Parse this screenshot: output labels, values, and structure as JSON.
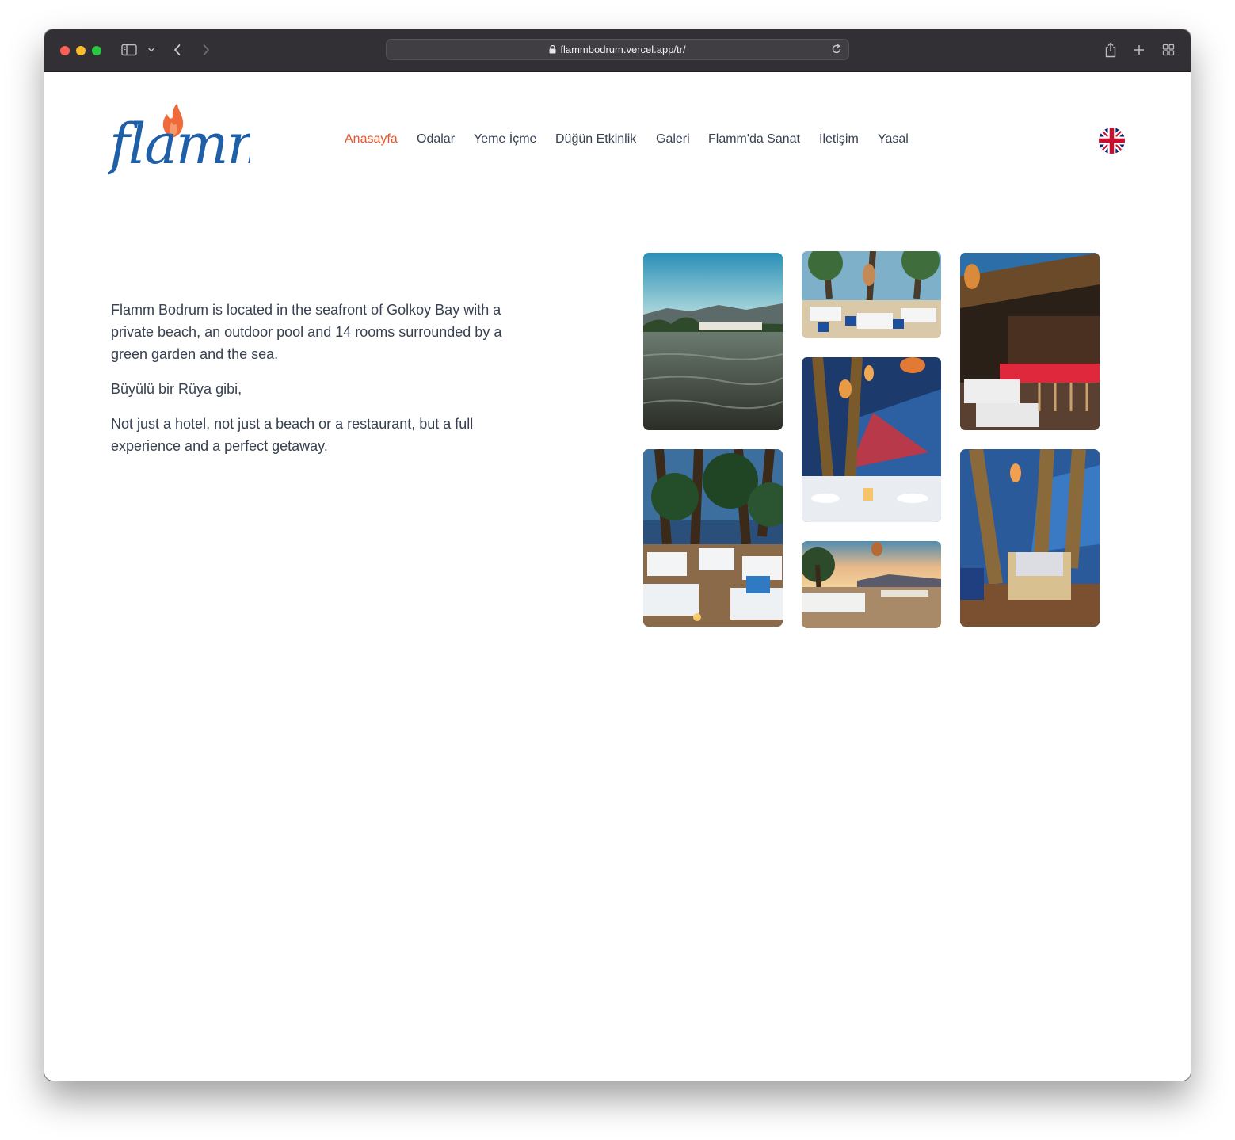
{
  "browser": {
    "url": "flammbodrum.vercel.app/tr/"
  },
  "header": {
    "logo_text": "flamm",
    "nav": [
      {
        "label": "Anasayfa",
        "active": true
      },
      {
        "label": "Odalar",
        "active": false
      },
      {
        "label": "Yeme İçme",
        "active": false
      },
      {
        "label": "Düğün Etkinlik",
        "active": false
      },
      {
        "label": "Galeri",
        "active": false
      },
      {
        "label": "Flamm'da Sanat",
        "active": false
      },
      {
        "label": "İletişim",
        "active": false
      },
      {
        "label": "Yasal",
        "active": false
      }
    ],
    "language_icon": "uk-flag-icon"
  },
  "intro": {
    "paragraph1": "Flamm Bodrum is located in the seafront of Golkoy Bay with a private beach, an outdoor pool and 14 rooms surrounded by a green garden and the sea.",
    "paragraph2": "Büyülü bir Rüya gibi,",
    "paragraph3": "Not just a hotel, not just a beach or a restaurant, but a full experience and a perfect getaway."
  },
  "gallery": {
    "photos": [
      "bay-sea-view",
      "beach-dining-palms",
      "bar-night",
      "palm-lanterns-dining",
      "dining-tables-evening",
      "sunset-beach-tables",
      "lounge-palms-night"
    ]
  },
  "colors": {
    "accent": "#e8542a",
    "logo_blue": "#1f5fa8",
    "text": "#374151"
  }
}
